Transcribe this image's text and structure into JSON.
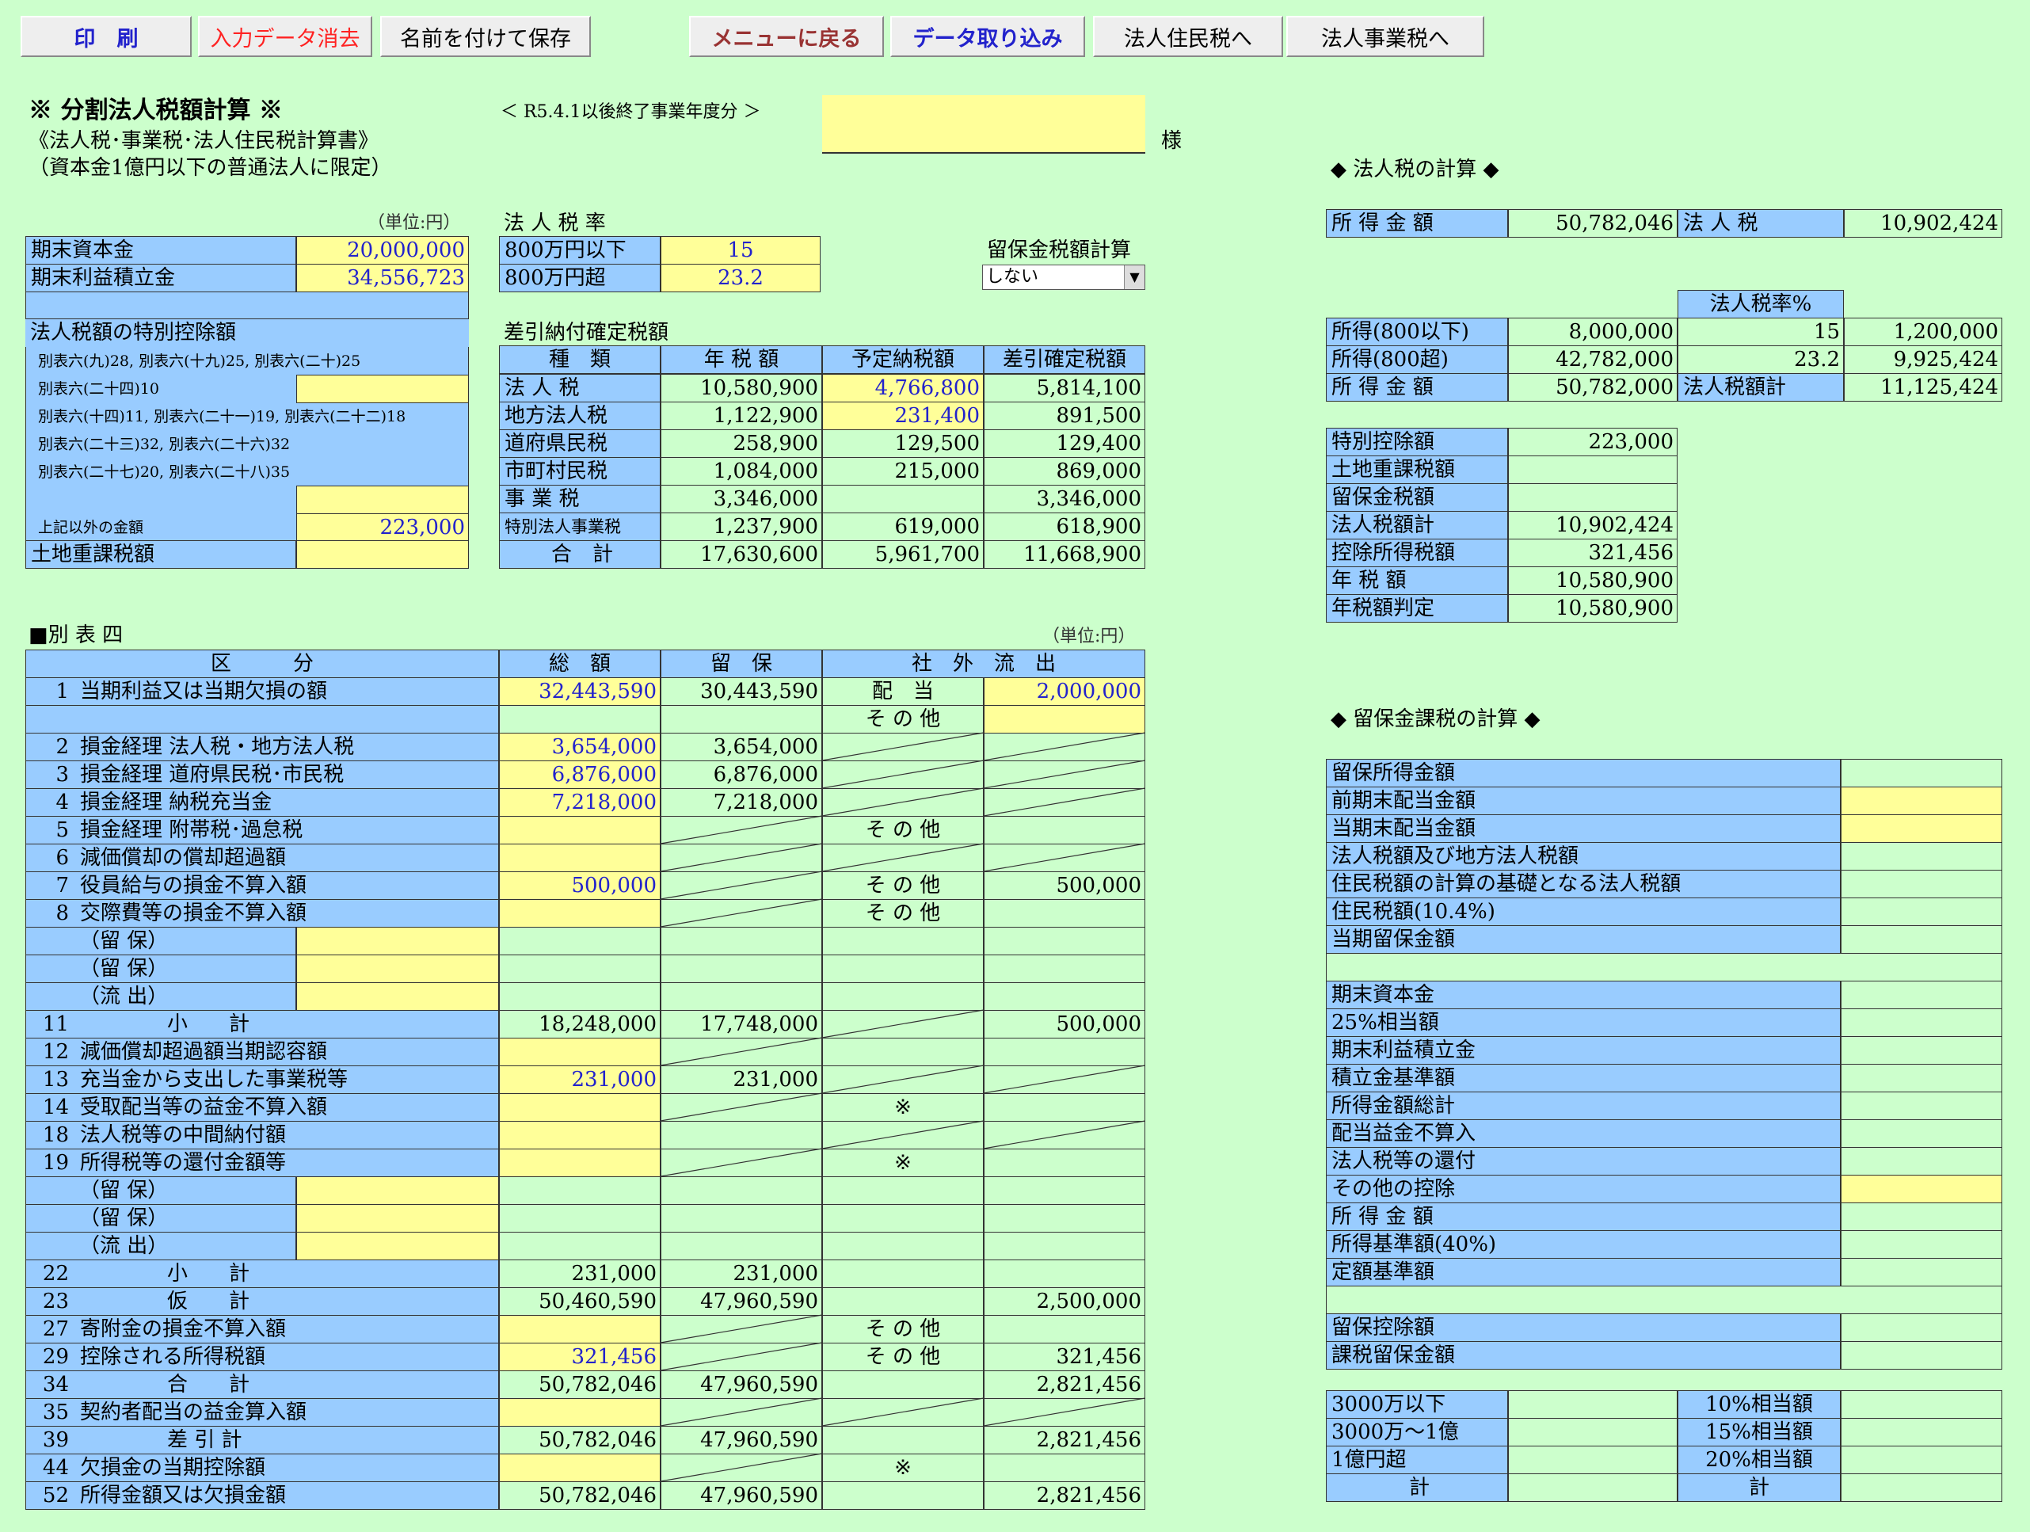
{
  "toolbar": {
    "print": "印　刷",
    "clear": "入力データ消去",
    "save_as": "名前を付けて保存",
    "menu": "メニューに戻る",
    "import": "データ取り込み",
    "juminzei": "法人住民税へ",
    "jigyozei": "法人事業税へ"
  },
  "header": {
    "title": "※ 分割法人税額計算 ※",
    "subtitle1": "《法人税･事業税･法人住民税計算書》",
    "subtitle2": "（資本金1億円以下の普通法人に限定）",
    "period": "＜ R5.4.1以後終了事業年度分 ＞",
    "company_name": "",
    "honorific": "様"
  },
  "unit": "（単位:円）",
  "capital": {
    "rows": [
      {
        "label": "期末資本金",
        "value": "20,000,000"
      },
      {
        "label": "期末利益積立金",
        "value": "34,556,723"
      }
    ]
  },
  "rate": {
    "title": "法 人 税 率",
    "rows": [
      {
        "label": "800万円以下",
        "value": "15"
      },
      {
        "label": "800万円超",
        "value": "23.2"
      }
    ]
  },
  "ryuho_select": {
    "label": "留保金税額計算",
    "value": "しない"
  },
  "tokubetsu": {
    "title": "法人税額の特別控除額",
    "rows": [
      {
        "label": "別表六(九)28, 別表六(十九)25, 別表六(二十)25",
        "value": ""
      },
      {
        "label": "別表六(二十四)10",
        "value": ""
      },
      {
        "label": "別表六(十四)11, 別表六(二十一)19, 別表六(二十二)18",
        "value": ""
      },
      {
        "label": "別表六(二十三)32, 別表六(二十六)32",
        "value": ""
      },
      {
        "label": "別表六(二十七)20, 別表六(二十八)35",
        "value": ""
      },
      {
        "label": "",
        "value": ""
      },
      {
        "label": "上記以外の金額",
        "value": "223,000"
      }
    ],
    "tochi_label": "土地重課税額",
    "tochi_value": ""
  },
  "sashihiki": {
    "title": "差引納付確定税額",
    "headers": [
      "種　類",
      "年 税 額",
      "予定納税額",
      "差引確定税額"
    ],
    "rows": [
      {
        "label": "法 人 税",
        "nen": "10,580,900",
        "yotei": "4,766,800",
        "kakutei": "5,814,100"
      },
      {
        "label": "地方法人税",
        "nen": "1,122,900",
        "yotei": "231,400",
        "kakutei": "891,500"
      },
      {
        "label": "道府県民税",
        "nen": "258,900",
        "yotei": "129,500",
        "kakutei": "129,400"
      },
      {
        "label": "市町村民税",
        "nen": "1,084,000",
        "yotei": "215,000",
        "kakutei": "869,000"
      },
      {
        "label": "事 業 税",
        "nen": "3,346,000",
        "yotei": "",
        "kakutei": "3,346,000"
      },
      {
        "label": "特別法人事業税",
        "nen": "1,237,900",
        "yotei": "619,000",
        "kakutei": "618,900"
      },
      {
        "label": "合　計",
        "nen": "17,630,600",
        "yotei": "5,961,700",
        "kakutei": "11,668,900"
      }
    ]
  },
  "beppyo4": {
    "title": "■別 表 四",
    "unit": "（単位:円）",
    "headers": [
      "区　　　分",
      "総　額",
      "留　保",
      "社　外　流　出"
    ],
    "rows": [
      {
        "no": "1",
        "label": "当期利益又は当期欠損の額",
        "sogaku": "32,443,590",
        "ryuho": "30,443,590",
        "sk": "配　当",
        "sv": "2,000,000"
      },
      {
        "no": "",
        "label": "",
        "sogaku": "",
        "ryuho": "",
        "sk": "そ の 他",
        "sv": ""
      },
      {
        "no": "2",
        "label": "損金経理 法人税・地方法人税",
        "sogaku": "3,654,000",
        "ryuho": "3,654,000",
        "sk": "",
        "sv": ""
      },
      {
        "no": "3",
        "label": "損金経理 道府県民税･市民税",
        "sogaku": "6,876,000",
        "ryuho": "6,876,000",
        "sk": "",
        "sv": ""
      },
      {
        "no": "4",
        "label": "損金経理 納税充当金",
        "sogaku": "7,218,000",
        "ryuho": "7,218,000",
        "sk": "",
        "sv": ""
      },
      {
        "no": "5",
        "label": "損金経理 附帯税･過怠税",
        "sogaku": "",
        "ryuho": "",
        "sk": "そ の 他",
        "sv": ""
      },
      {
        "no": "6",
        "label": "減価償却の償却超過額",
        "sogaku": "",
        "ryuho": "",
        "sk": "",
        "sv": ""
      },
      {
        "no": "7",
        "label": "役員給与の損金不算入額",
        "sogaku": "500,000",
        "ryuho": "",
        "sk": "そ の 他",
        "sv": "500,000"
      },
      {
        "no": "8",
        "label": "交際費等の損金不算入額",
        "sogaku": "",
        "ryuho": "",
        "sk": "そ の 他",
        "sv": ""
      },
      {
        "no": "",
        "label": "（留 保）",
        "sogaku": "",
        "ryuho": "",
        "sk": "",
        "sv": ""
      },
      {
        "no": "",
        "label": "（留 保）",
        "sogaku": "",
        "ryuho": "",
        "sk": "",
        "sv": ""
      },
      {
        "no": "",
        "label": "（流 出）",
        "sogaku": "",
        "ryuho": "",
        "sk": "",
        "sv": ""
      },
      {
        "no": "11",
        "label": "小　　計",
        "sogaku": "18,248,000",
        "ryuho": "17,748,000",
        "sk": "",
        "sv": "500,000"
      },
      {
        "no": "12",
        "label": "減価償却超過額当期認容額",
        "sogaku": "",
        "ryuho": "",
        "sk": "",
        "sv": ""
      },
      {
        "no": "13",
        "label": "充当金から支出した事業税等",
        "sogaku": "231,000",
        "ryuho": "231,000",
        "sk": "",
        "sv": ""
      },
      {
        "no": "14",
        "label": "受取配当等の益金不算入額",
        "sogaku": "",
        "ryuho": "",
        "sk": "※",
        "sv": ""
      },
      {
        "no": "18",
        "label": "法人税等の中間納付額",
        "sogaku": "",
        "ryuho": "",
        "sk": "",
        "sv": ""
      },
      {
        "no": "19",
        "label": "所得税等の還付金額等",
        "sogaku": "",
        "ryuho": "",
        "sk": "※",
        "sv": ""
      },
      {
        "no": "",
        "label": "（留 保）",
        "sogaku": "",
        "ryuho": "",
        "sk": "",
        "sv": ""
      },
      {
        "no": "",
        "label": "（留 保）",
        "sogaku": "",
        "ryuho": "",
        "sk": "",
        "sv": ""
      },
      {
        "no": "",
        "label": "（流 出）",
        "sogaku": "",
        "ryuho": "",
        "sk": "",
        "sv": ""
      },
      {
        "no": "22",
        "label": "小　　計",
        "sogaku": "231,000",
        "ryuho": "231,000",
        "sk": "",
        "sv": ""
      },
      {
        "no": "23",
        "label": "仮　　計",
        "sogaku": "50,460,590",
        "ryuho": "47,960,590",
        "sk": "",
        "sv": "2,500,000"
      },
      {
        "no": "27",
        "label": "寄附金の損金不算入額",
        "sogaku": "",
        "ryuho": "",
        "sk": "そ の 他",
        "sv": ""
      },
      {
        "no": "29",
        "label": "控除される所得税額",
        "sogaku": "321,456",
        "ryuho": "",
        "sk": "そ の 他",
        "sv": "321,456"
      },
      {
        "no": "34",
        "label": "合　　計",
        "sogaku": "50,782,046",
        "ryuho": "47,960,590",
        "sk": "",
        "sv": "2,821,456"
      },
      {
        "no": "35",
        "label": "契約者配当の益金算入額",
        "sogaku": "",
        "ryuho": "",
        "sk": "",
        "sv": ""
      },
      {
        "no": "39",
        "label": "差 引 計",
        "sogaku": "50,782,046",
        "ryuho": "47,960,590",
        "sk": "",
        "sv": "2,821,456"
      },
      {
        "no": "44",
        "label": "欠損金の当期控除額",
        "sogaku": "",
        "ryuho": "",
        "sk": "※",
        "sv": ""
      },
      {
        "no": "52",
        "label": "所得金額又は欠損金額",
        "sogaku": "50,782,046",
        "ryuho": "47,960,590",
        "sk": "",
        "sv": "2,821,456"
      }
    ]
  },
  "hojinzei": {
    "title": "◆ 法人税の計算 ◆",
    "shotoku_label": "所 得 金 額",
    "shotoku": "50,782,046",
    "hojinzei_label": "法 人 税",
    "hojinzei": "10,902,424",
    "rate_header": "法人税率%",
    "rows": [
      {
        "label": "所得(800以下)",
        "amount": "8,000,000",
        "rate": "15",
        "tax": "1,200,000"
      },
      {
        "label": "所得(800超)",
        "amount": "42,782,000",
        "rate": "23.2",
        "tax": "9,925,424"
      },
      {
        "label": "所 得 金 額",
        "amount": "50,782,000",
        "rate": "法人税額計",
        "tax": "11,125,424"
      }
    ],
    "summary": [
      {
        "label": "特別控除額",
        "value": "223,000"
      },
      {
        "label": "土地重課税額",
        "value": ""
      },
      {
        "label": "留保金税額",
        "value": ""
      },
      {
        "label": "法人税額計",
        "value": "10,902,424"
      },
      {
        "label": "控除所得税額",
        "value": "321,456"
      },
      {
        "label": "年 税 額",
        "value": "10,580,900"
      },
      {
        "label": "年税額判定",
        "value": "10,580,900"
      }
    ]
  },
  "ryuhokin": {
    "title": "◆ 留保金課税の計算 ◆",
    "group1": [
      "留保所得金額",
      "前期末配当金額",
      "当期末配当金額",
      "法人税額及び地方法人税額",
      "住民税額の計算の基礎となる法人税額",
      "住民税額(10.4%)",
      "当期留保金額"
    ],
    "group2": [
      "期末資本金",
      "25%相当額",
      "期末利益積立金",
      "積立金基準額",
      "所得金額総計",
      "配当益金不算入",
      "法人税等の還付",
      "その他の控除",
      "所 得 金 額",
      "所得基準額(40%)",
      "定額基準額"
    ],
    "group3": [
      "留保控除額",
      "課税留保金額"
    ],
    "brackets": [
      {
        "label": "3000万以下",
        "rate": "10%相当額"
      },
      {
        "label": "3000万～1億",
        "rate": "15%相当額"
      },
      {
        "label": "1億円超",
        "rate": "20%相当額"
      },
      {
        "label": "計",
        "rate": "計"
      }
    ]
  },
  "colors": {
    "bg": "#CCFFCC",
    "label": "#99CCFF",
    "input": "#FFFF99",
    "blue_text": "#2222CC"
  }
}
